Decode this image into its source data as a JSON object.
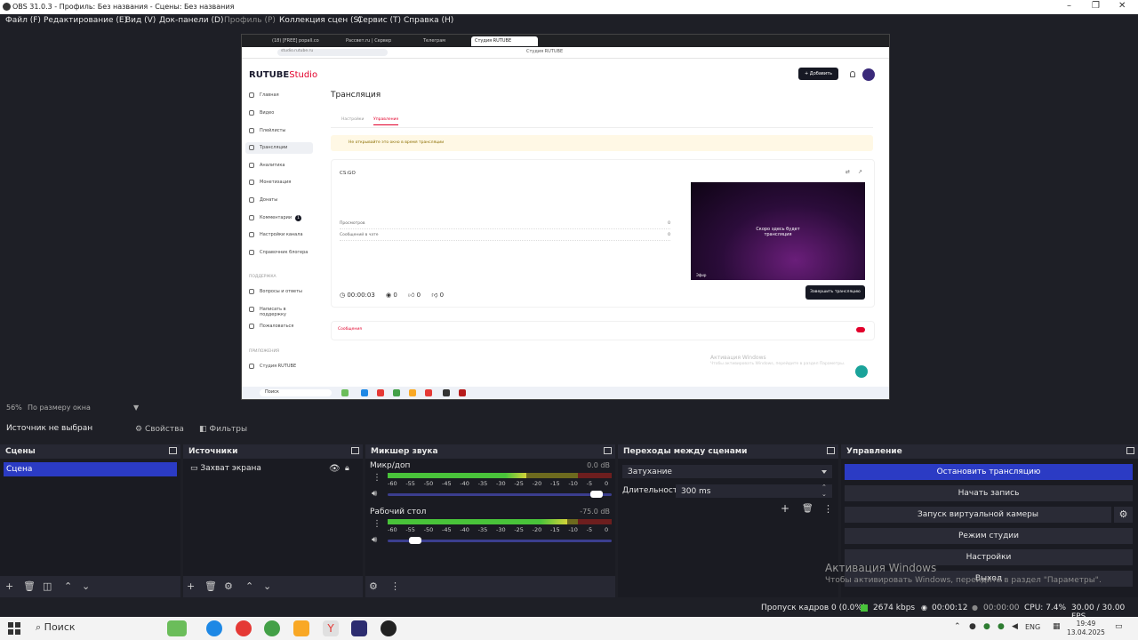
{
  "window": {
    "title": "OBS 31.0.3 - Профиль: Без названия - Сцены: Без названия"
  },
  "menu": {
    "file": "Файл (F)",
    "edit": "Редактирование (E)",
    "view": "Вид (V)",
    "docks": "Док-панели (D)",
    "profile": "Профиль (P)",
    "scene_collection": "Коллекция сцен (S)",
    "tools": "Сервис (T)",
    "help": "Справка (H)"
  },
  "preview": {
    "browser": {
      "tabs": [
        "(18) [FREE] popall.co",
        "Рассвет.ru | Сервер",
        "Телеграм",
        "Студия RUTUBE"
      ],
      "url": "studio.rutube.ru",
      "page_title": "Студия RUTUBE"
    },
    "rutube": {
      "logo": "RUTUBE",
      "logo_suffix": "Studio",
      "add_button": "+ Добавить",
      "nav": [
        "Главная",
        "Видео",
        "Плейлисты",
        "Трансляции",
        "Аналитика",
        "Монетизация",
        "Донаты",
        "Комментарии",
        "Настройки канала",
        "Справочник блогера"
      ],
      "comments_badge": "1",
      "section_support": "ПОДДЕРЖКА",
      "support_items": [
        "Вопросы и ответы",
        "Написать в поддержку",
        "Пожаловаться"
      ],
      "section_apps": "ПРИЛОЖЕНИЯ",
      "apps_items": [
        "Студия RUTUBE"
      ],
      "page_title": "Трансляция",
      "subtabs": [
        "Настройки",
        "Управление"
      ],
      "warning": "Не открывайте это окно в время трансляции",
      "stream_title": "CS:GO",
      "stats": [
        {
          "label": "Просмотров",
          "value": "0"
        },
        {
          "label": "Сообщений в чате",
          "value": "0"
        }
      ],
      "player_msg": "Скоро здесь будет трансляция",
      "player_live": "Эфир",
      "timer": "00:00:03",
      "views": "0",
      "likes": "0",
      "dislikes": "0",
      "end_button": "Завершить трансляцию",
      "chat_label": "Сообщения",
      "win_activation": "Активация Windows",
      "win_activation_sub": "Чтобы активировать Windows, перейдите в раздел Параметры.",
      "taskbar_search": "Поиск"
    }
  },
  "zoom": {
    "percent": "56%",
    "mode": "По размеру окна"
  },
  "source_toolbar": {
    "no_source": "Источник не выбран",
    "properties": "Свойства",
    "filters": "Фильтры"
  },
  "docks": {
    "scenes": {
      "title": "Сцены",
      "items": [
        "Сцена"
      ]
    },
    "sources": {
      "title": "Источники",
      "items": [
        "Захват экрана"
      ]
    },
    "mixer": {
      "title": "Микшер звука",
      "channels": [
        {
          "name": "Микр/доп",
          "db": "0.0 dB",
          "level": 0.62,
          "volume": 0.96
        },
        {
          "name": "Рабочий стол",
          "db": "-75.0 dB",
          "level": 0.8,
          "volume": 0.1
        }
      ],
      "ticks": [
        "-60",
        "-55",
        "-50",
        "-45",
        "-40",
        "-35",
        "-30",
        "-25",
        "-20",
        "-15",
        "-10",
        "-5",
        "0"
      ]
    },
    "transitions": {
      "title": "Переходы между сценами",
      "selected": "Затухание",
      "duration_label": "Длительность",
      "duration": "300 ms"
    },
    "controls": {
      "title": "Управление",
      "stop_stream": "Остановить трансляцию",
      "start_record": "Начать запись",
      "virtual_cam": "Запуск виртуальной камеры",
      "studio_mode": "Режим студии",
      "settings": "Настройки",
      "exit": "Выход"
    }
  },
  "status": {
    "dropped": "Пропуск кадров 0 (0.0%)",
    "bitrate": "2674 kbps",
    "stream_time": "00:00:12",
    "rec_time": "00:00:00",
    "cpu": "CPU: 7.4%",
    "fps": "30.00 / 30.00 FPS"
  },
  "watermark": {
    "title": "Активация Windows",
    "sub": "Чтобы активировать Windows, перейдите в раздел \"Параметры\"."
  },
  "taskbar": {
    "search": "Поиск",
    "lang": "ENG",
    "time": "19:49",
    "date": "13.04.2025"
  },
  "colors": {
    "accent": "#2b3bc4",
    "rutube_red": "#e2002b",
    "background": "#1e1f26"
  }
}
